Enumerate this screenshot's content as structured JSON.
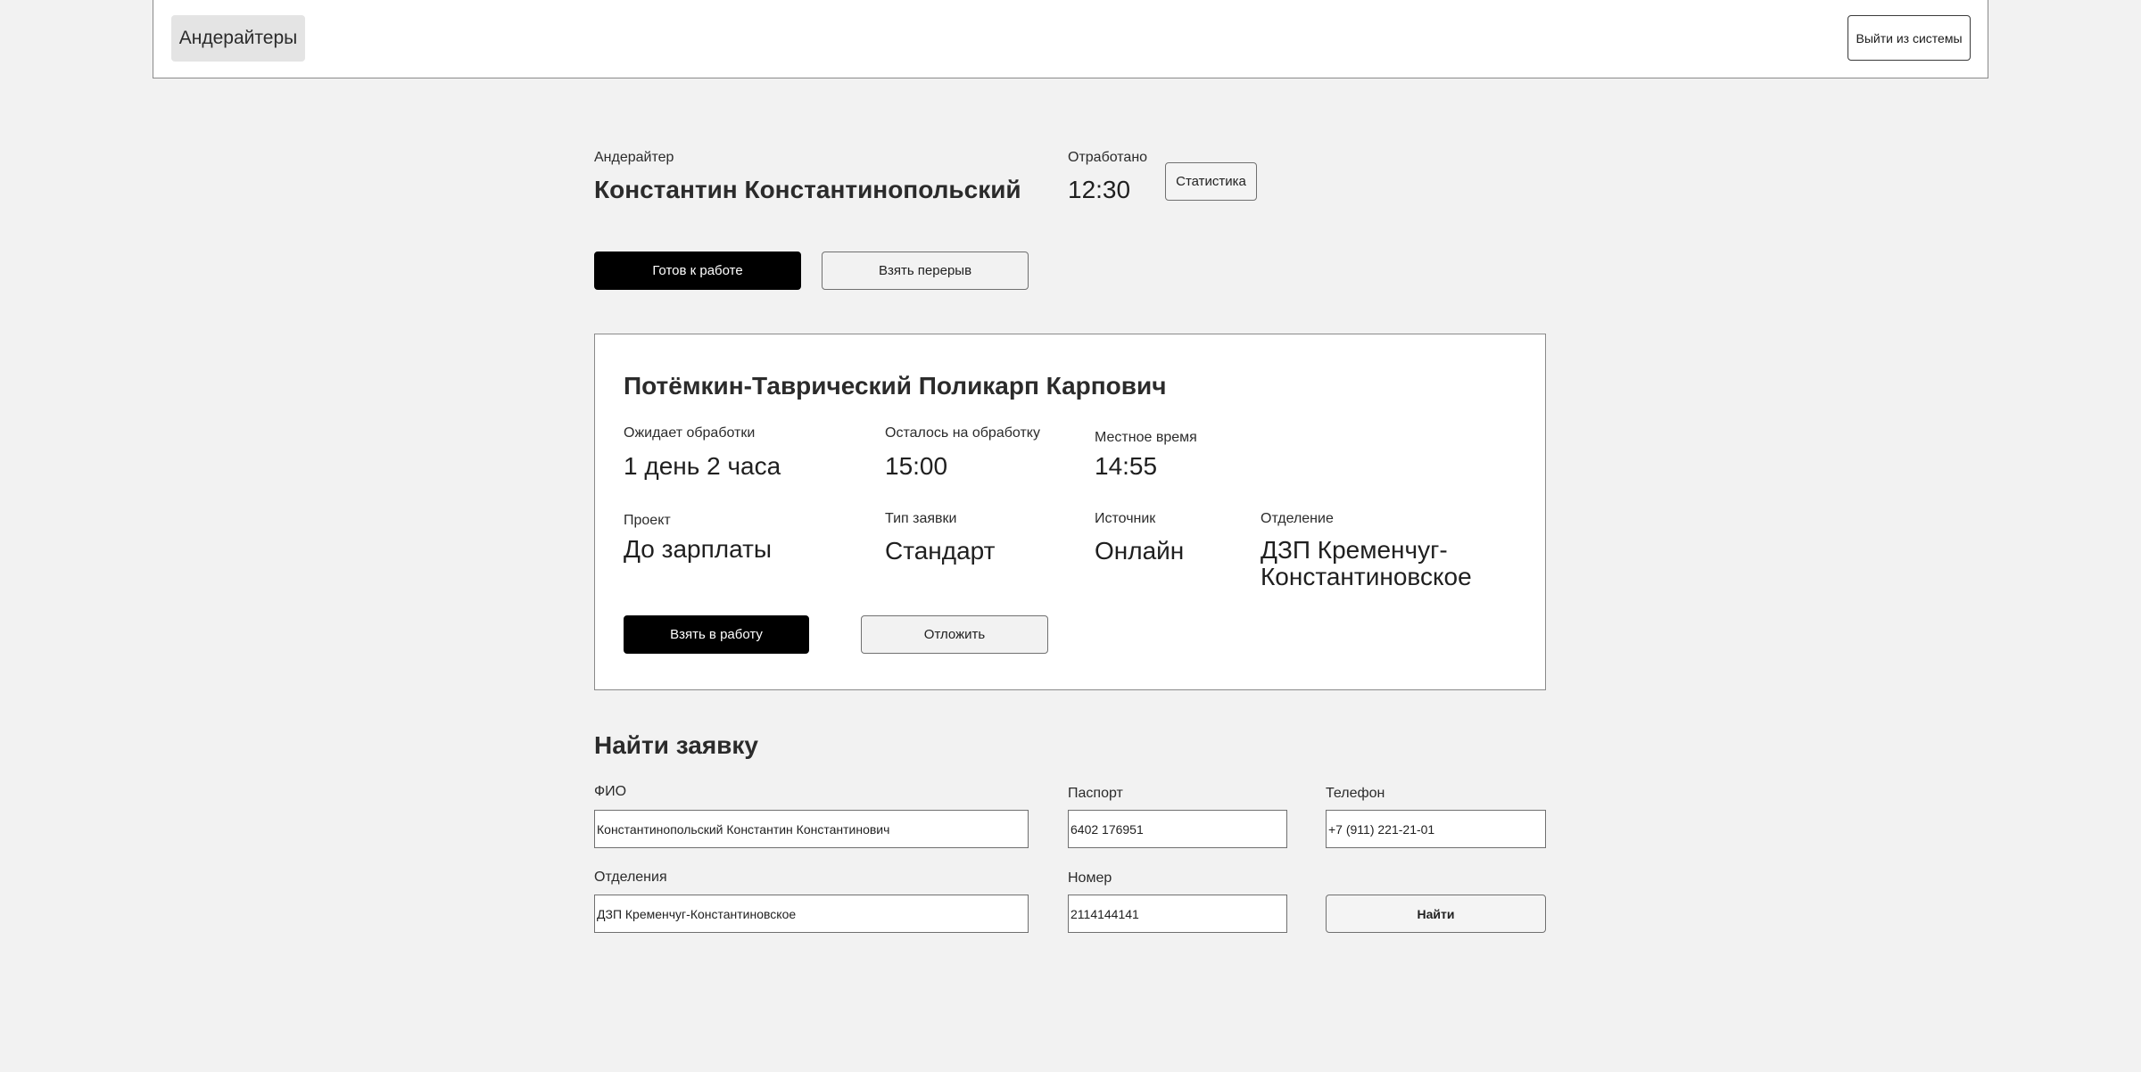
{
  "header": {
    "brand": "Андерайтеры",
    "logout_label": "Выйти из системы"
  },
  "operator": {
    "role_label": "Андерайтер",
    "name": "Константин Константинопольский",
    "worked_label": "Отработано",
    "worked_value": "12:30",
    "stats_label": "Статистика",
    "ready_label": "Готов к работе",
    "break_label": "Взять перерыв"
  },
  "request": {
    "client_name": "Потёмкин-Таврический Поликарп Карпович",
    "waiting_label": "Ожидает обработки",
    "waiting_value": "1 день 2 часа",
    "remaining_label": "Осталось на обработку",
    "remaining_value": "15:00",
    "local_time_label": "Местное время",
    "local_time_value": "14:55",
    "project_label": "Проект",
    "project_value": "До зарплаты",
    "type_label": "Тип заявки",
    "type_value": "Стандарт",
    "source_label": "Источник",
    "source_value": "Онлайн",
    "branch_label": "Отделение",
    "branch_value_line1": "ДЗП Кременчуг-",
    "branch_value_line2": "Константиновское",
    "take_label": "Взять в работу",
    "postpone_label": "Отложить"
  },
  "search": {
    "title": "Найти заявку",
    "fio_label": "ФИО",
    "fio_value": "Константинопольский Константин Константинович",
    "passport_label": "Паспорт",
    "passport_value": "6402 176951",
    "phone_label": "Телефон",
    "phone_value": "+7 (911) 221-21-01",
    "branches_label": "Отделения",
    "branches_value": "ДЗП Кременчуг-Константиновское",
    "number_label": "Номер",
    "number_value": "2114144141",
    "find_label": "Найти"
  }
}
